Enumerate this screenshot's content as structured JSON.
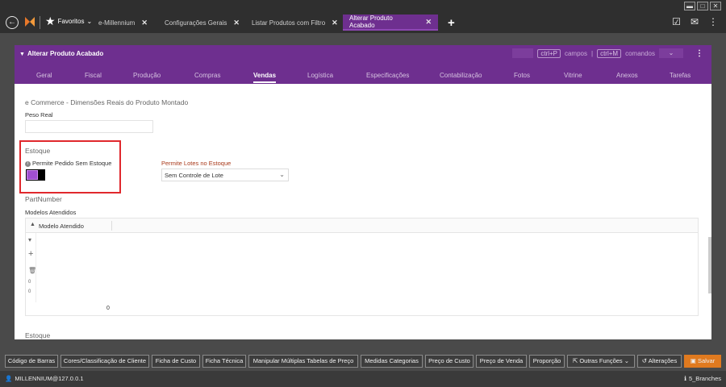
{
  "top": {
    "favoritos": "Favoritos",
    "tabs": [
      {
        "label": "e-Millennium"
      },
      {
        "label": "Configurações Gerais"
      },
      {
        "label": "Listar Produtos com Filtro"
      },
      {
        "label": "Alterar Produto Acabado"
      }
    ],
    "icons": {
      "back": "back-arrow-icon",
      "logo": "millennium-logo-icon",
      "star": "star-icon",
      "add_tab": "plus-icon",
      "clipboard": "clipboard-icon",
      "chat": "chat-icon",
      "more": "kebab-icon"
    },
    "accent_color": "#6e2f8f"
  },
  "panel": {
    "title": "Alterar Produto Acabado",
    "shortcut_campos_key": "ctrl+P",
    "shortcut_campos_label": "campos",
    "divider": "|",
    "shortcut_comandos_key": "ctrl+M",
    "shortcut_comandos_label": "comandos",
    "dropdown_chevron": "⌄",
    "tabs": [
      "Geral",
      "Fiscal",
      "Produção",
      "Compras",
      "Vendas",
      "Logística",
      "Especificações",
      "Contabilização",
      "Fotos",
      "Vitrine",
      "Anexos",
      "Tarefas"
    ],
    "active_tab": "Vendas"
  },
  "form": {
    "ecommerce_title": "e Commerce - Dimensões Reais do Produto Montado",
    "peso_real_label": "Peso Real",
    "peso_real_value": "",
    "estoque_title": "Estoque",
    "permite_pedido_label": "Permite Pedido Sem Estoque",
    "permite_pedido_on": true,
    "permite_lotes_label": "Permite Lotes no Estoque",
    "permite_lotes_value": "Sem Controle de Lote",
    "partnumber_label": "PartNumber",
    "modelos_label": "Modelos Atendidos",
    "grid_column": "Modelo Atendido",
    "grid_count_top": "0",
    "grid_count_bottom": "0",
    "grid_total": "0",
    "estoque_bottom_title": "Estoque"
  },
  "bottom_buttons": [
    "Código de Barras",
    "Cores/Classificação de Cliente",
    "Ficha de Custo",
    "Ficha Técnica",
    "Manipular Múltiplas Tabelas de Preço",
    "Medidas Categorias",
    "Preço de Custo",
    "Preço de Venda",
    "Proporção",
    "Outras Funções",
    "Alterações",
    "Salvar"
  ],
  "status": {
    "user": "MILLENNIUM@127.0.0.1",
    "branch": "5_Branches"
  }
}
